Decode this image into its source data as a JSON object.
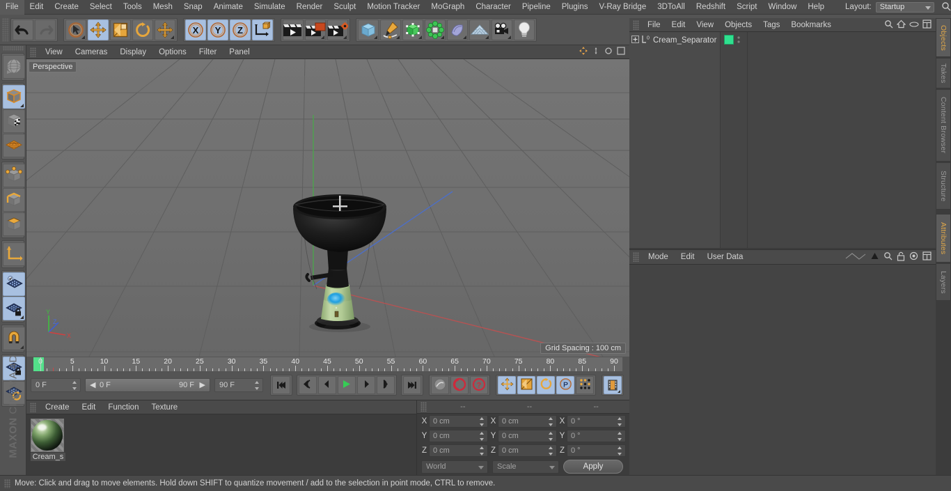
{
  "app": {
    "title": "Cinema 4D",
    "brand_line1": "MAXON",
    "brand_line2": "CINEMA 4D"
  },
  "menubar": {
    "items": [
      "File",
      "Edit",
      "Create",
      "Select",
      "Tools",
      "Mesh",
      "Snap",
      "Animate",
      "Simulate",
      "Render",
      "Sculpt",
      "Motion Tracker",
      "MoGraph",
      "Character",
      "Pipeline",
      "Plugins",
      "V-Ray Bridge",
      "3DToAll",
      "Redshift",
      "Script",
      "Window",
      "Help"
    ],
    "layout_label": "Layout:",
    "layout_value": "Startup"
  },
  "toolbar": {
    "groups": [
      {
        "name": "history",
        "buttons": [
          {
            "icon": "undo-icon",
            "label": "Undo",
            "selected": false,
            "disabled": false
          },
          {
            "icon": "redo-icon",
            "label": "Redo",
            "selected": false,
            "disabled": true
          }
        ]
      },
      {
        "name": "transform",
        "buttons": [
          {
            "icon": "live-selection-icon",
            "label": "Live Selection",
            "selected": false,
            "corner": true
          },
          {
            "icon": "move-icon",
            "label": "Move",
            "selected": true
          },
          {
            "icon": "scale-icon",
            "label": "Scale",
            "selected": false
          },
          {
            "icon": "rotate-icon",
            "label": "Rotate",
            "selected": false
          },
          {
            "icon": "move-axis-icon",
            "label": "Move Axis",
            "selected": false,
            "corner": true
          }
        ]
      },
      {
        "name": "axis-locks",
        "buttons": [
          {
            "icon": "axis-x-icon",
            "label": "X Axis",
            "selected": true
          },
          {
            "icon": "axis-y-icon",
            "label": "Y Axis",
            "selected": true
          },
          {
            "icon": "axis-z-icon",
            "label": "Z Axis",
            "selected": true
          },
          {
            "icon": "world-coordinates-icon",
            "label": "World/Object Coordinate System",
            "selected": true
          }
        ]
      },
      {
        "name": "render",
        "buttons": [
          {
            "icon": "render-view-icon",
            "label": "Render View",
            "selected": false
          },
          {
            "icon": "render-region-icon",
            "label": "Render to Picture Viewer",
            "selected": false,
            "corner": true
          },
          {
            "icon": "render-settings-icon",
            "label": "Edit Render Settings",
            "selected": false,
            "corner": true
          }
        ]
      },
      {
        "name": "create",
        "buttons": [
          {
            "icon": "cube-primitive-icon",
            "label": "Add Cube Object",
            "selected": false,
            "corner": true
          },
          {
            "icon": "spline-pen-icon",
            "label": "Add Spline",
            "selected": false,
            "corner": true
          },
          {
            "icon": "generator-icon",
            "label": "Add Generator Object",
            "selected": false,
            "corner": true
          },
          {
            "icon": "deformer-icon",
            "label": "Add Deformer Object",
            "selected": false,
            "corner": true
          },
          {
            "icon": "scene-object-icon",
            "label": "Add Scene Object",
            "selected": false,
            "corner": true
          },
          {
            "icon": "floor-icon",
            "label": "Add Floor Object",
            "selected": false,
            "corner": true
          },
          {
            "icon": "camera-icon",
            "label": "Add Camera Object",
            "selected": false,
            "corner": true
          },
          {
            "icon": "light-icon",
            "label": "Add Light Object",
            "selected": false
          }
        ]
      }
    ]
  },
  "left_toolbar": {
    "groups": [
      {
        "buttons": [
          {
            "icon": "make-editable-icon",
            "label": "Make Editable",
            "selected": false
          }
        ]
      },
      {
        "buttons": [
          {
            "icon": "model-mode-icon",
            "label": "Model Mode",
            "selected": true,
            "corner": true
          },
          {
            "icon": "texture-mode-icon",
            "label": "Texture Mode",
            "selected": false
          },
          {
            "icon": "workplane-mode-icon",
            "label": "Workplane Mode",
            "selected": false
          }
        ]
      },
      {
        "buttons": [
          {
            "icon": "points-mode-icon",
            "label": "Points Mode",
            "selected": false
          },
          {
            "icon": "edges-mode-icon",
            "label": "Edges Mode",
            "selected": false
          },
          {
            "icon": "polygons-mode-icon",
            "label": "Polygons Mode",
            "selected": false
          }
        ]
      },
      {
        "buttons": [
          {
            "icon": "object-axis-icon",
            "label": "Enable Axis Modification",
            "selected": false
          }
        ]
      },
      {
        "buttons": [
          {
            "icon": "viewport-solo-icon",
            "label": "Viewport Solo Single",
            "selected": true
          },
          {
            "icon": "soft-selection-icon",
            "label": "Soft Selection",
            "selected": true,
            "corner": true
          }
        ]
      },
      {
        "buttons": [
          {
            "icon": "magnet-icon",
            "label": "Enable Snapping",
            "selected": false,
            "corner": true
          }
        ]
      },
      {
        "buttons": [
          {
            "icon": "lock-workplane-icon",
            "label": "Lock Workplane",
            "selected": true
          },
          {
            "icon": "planar-workplane-icon",
            "label": "Planar Workplane",
            "selected": false
          }
        ]
      }
    ]
  },
  "viewport": {
    "menu": [
      "View",
      "Cameras",
      "Display",
      "Options",
      "Filter",
      "Panel"
    ],
    "label": "Perspective",
    "grid_spacing": "Grid Spacing : 100 cm",
    "axis_gizmo": {
      "x": "X",
      "y": "Y",
      "z": "Z",
      "x_color": "#d04040",
      "y_color": "#40c040",
      "z_color": "#4060d0"
    },
    "scene_object": "Cream Separator",
    "background_color": "#6e6e6e",
    "grid_color": "#5a5a5a"
  },
  "timeline": {
    "ticks": [
      0,
      5,
      10,
      15,
      20,
      25,
      30,
      35,
      40,
      45,
      50,
      55,
      60,
      65,
      70,
      75,
      80,
      85,
      90
    ],
    "current_frame_marker": 0,
    "fields": {
      "current_frame": "0 F",
      "range_start": "0 F",
      "range_end": "90 F",
      "max_frame": "90 F",
      "preview_frame": "0 F"
    },
    "transport": [
      {
        "icon": "go-to-start-icon",
        "label": "Go to Start of Animation"
      },
      {
        "icon": "previous-key-icon",
        "label": "Go to Previous Key"
      },
      {
        "icon": "previous-frame-icon",
        "label": "Go to Previous Frame"
      },
      {
        "icon": "play-forwards-icon",
        "label": "Play Forwards",
        "selected": false
      },
      {
        "icon": "next-frame-icon",
        "label": "Go to Next Frame"
      },
      {
        "icon": "next-key-icon",
        "label": "Go to Next Key"
      },
      {
        "icon": "go-to-end-icon",
        "label": "Go to End of Animation"
      }
    ],
    "record_group": [
      {
        "icon": "record-active-objects-icon",
        "label": "Record Active Objects"
      },
      {
        "icon": "autokeying-icon",
        "label": "Autokeying"
      },
      {
        "icon": "keyframe-selection-icon",
        "label": "Keyframe Selection"
      }
    ],
    "param_group": [
      {
        "icon": "position-key-icon",
        "label": "Position",
        "selected": true
      },
      {
        "icon": "scale-key-icon",
        "label": "Scale",
        "selected": true
      },
      {
        "icon": "rotation-key-icon",
        "label": "Rotation",
        "selected": true
      },
      {
        "icon": "parameter-key-icon",
        "label": "Parameter",
        "selected": true
      },
      {
        "icon": "point-level-animation-icon",
        "label": "Point Level Animation",
        "selected": false
      }
    ],
    "extra": [
      {
        "icon": "timeline-filmstrip-icon",
        "label": "Animation Mode",
        "selected": true,
        "corner": true
      }
    ]
  },
  "materials": {
    "menu": [
      "Create",
      "Edit",
      "Function",
      "Texture"
    ],
    "items": [
      {
        "name": "Cream_s",
        "preview": "green-black-sphere"
      }
    ]
  },
  "coordinates": {
    "headers": [
      "--",
      "--",
      "--"
    ],
    "rows": [
      {
        "label": "X",
        "position": "0 cm",
        "size": "0 cm",
        "rotation": "0 °"
      },
      {
        "label": "Y",
        "position": "0 cm",
        "size": "0 cm",
        "rotation": "0 °"
      },
      {
        "label": "Z",
        "position": "0 cm",
        "size": "0 cm",
        "rotation": "0 °"
      }
    ],
    "coord_system": "World",
    "size_mode": "Scale",
    "apply_label": "Apply"
  },
  "object_manager": {
    "menu": [
      "File",
      "Edit",
      "View",
      "Objects",
      "Tags",
      "Bookmarks"
    ],
    "icons": [
      "search-icon",
      "home-icon",
      "eye-icon",
      "new-layer-icon"
    ],
    "objects": [
      {
        "name": "Cream_Separator",
        "tag_color": "#2fe08f",
        "expandable": true,
        "layer_badge": "0"
      }
    ]
  },
  "attribute_manager": {
    "menu": [
      "Mode",
      "Edit",
      "User Data"
    ],
    "icons": [
      "interpolation-icon",
      "arrow-up-icon",
      "search-icon",
      "unlock-icon",
      "target-icon",
      "new-tab-icon"
    ]
  },
  "right_tabs": {
    "top": [
      {
        "label": "Objects",
        "active": true
      },
      {
        "label": "Takes",
        "active": false
      },
      {
        "label": "Content Browser",
        "active": false
      },
      {
        "label": "Structure",
        "active": false
      }
    ],
    "bottom": [
      {
        "label": "Attributes",
        "active": true
      },
      {
        "label": "Layers",
        "active": false
      }
    ]
  },
  "statusbar": {
    "text": "Move: Click and drag to move elements. Hold down SHIFT to quantize movement / add to the selection in point mode, CTRL to remove."
  }
}
